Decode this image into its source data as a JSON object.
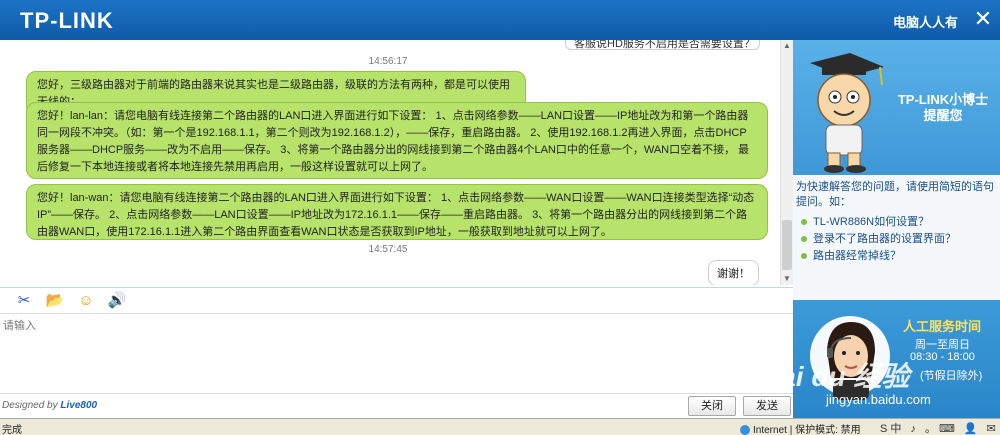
{
  "header": {
    "logo": "TP-LINK",
    "user": "电脑人人有",
    "close": "✕"
  },
  "chat": {
    "prev_message": "客服说HD服务不启用是否需要设置？",
    "messages": [
      {
        "type": "time",
        "text": "14:56:17"
      },
      {
        "type": "agent",
        "text": "您好，三级路由器对于前端的路由器来说其实也是二级路由器，级联的方法有两种，都是可以使用无线的："
      },
      {
        "type": "agent",
        "text": "您好！lan-lan：请您电脑有线连接第二个路由器的LAN口进入界面进行如下设置： 1、点击网络参数——LAN口设置——IP地址改为和第一个路由器同一网段不冲突。（如：第一个是192.168.1.1，第二个则改为192.168.1.2），——保存，重启路由器。 2、使用192.168.1.2再进入界面，点击DHCP服务器——DHCP服务——改为不启用——保存。 3、将第一个路由器分出的网线接到第二个路由器4个LAN口中的任意一个，WAN口空着不接， 最后修复一下本地连接或者将本地连接先禁用再启用，一般这样设置就可以上网了。"
      },
      {
        "type": "agent",
        "text": "您好！lan-wan：请您电脑有线连接第二个路由器的LAN口进入界面进行如下设置： 1、点击网络参数——WAN口设置——WAN口连接类型选择“动态IP”——保存。 2、点击网络参数——LAN口设置——IP地址改为172.16.1.1——保存——重启路由器。 3、将第一个路由器分出的网线接到第二个路由器WAN口，使用172.16.1.1进入第二个路由界面查看WAN口状态是否获取到IP地址，一般获取到地址就可以上网了。"
      },
      {
        "type": "time",
        "text": "14:57:45"
      },
      {
        "type": "user",
        "text": "谢谢！"
      }
    ]
  },
  "toolbar": {
    "tools": [
      {
        "name": "screenshot-icon",
        "glyph": "✂"
      },
      {
        "name": "file-transfer-icon",
        "glyph": "📂"
      },
      {
        "name": "emoticon-icon",
        "glyph": "☺"
      },
      {
        "name": "sound-icon",
        "glyph": "🔊"
      }
    ]
  },
  "input": {
    "placeholder": "请输入"
  },
  "footer": {
    "designed_by": "Designed by",
    "brand": "Live800",
    "close_label": "关闭",
    "send_label": "发送"
  },
  "panel": {
    "doctor_title_line1": "TP-LINK小博士",
    "doctor_title_line2": "提醒您",
    "intro": "为快速解答您的问题，请使用简短的语句提问。如：",
    "tips": [
      "TL-WR886N如何设置？",
      "登录不了路由器的设置界面？",
      "路由器经常掉线？"
    ],
    "service_title": "人工服务时间",
    "service_days": "周一至周日",
    "service_hours": "08:30 - 18:00",
    "service_holiday": "(节假日除外)"
  },
  "watermark": {
    "brand": "Bai du 经验",
    "url": "jingyan.baidu.com"
  },
  "statusbar": {
    "left": "完成",
    "zone": "Internet | 保护模式: 禁用",
    "tray": "S中 ♪ 。⌨ 👤 ✉"
  },
  "colors": {
    "header_blue": "#1c74c5",
    "bubble_green": "#b7e36a",
    "panel_blue": "#4ca5df"
  }
}
